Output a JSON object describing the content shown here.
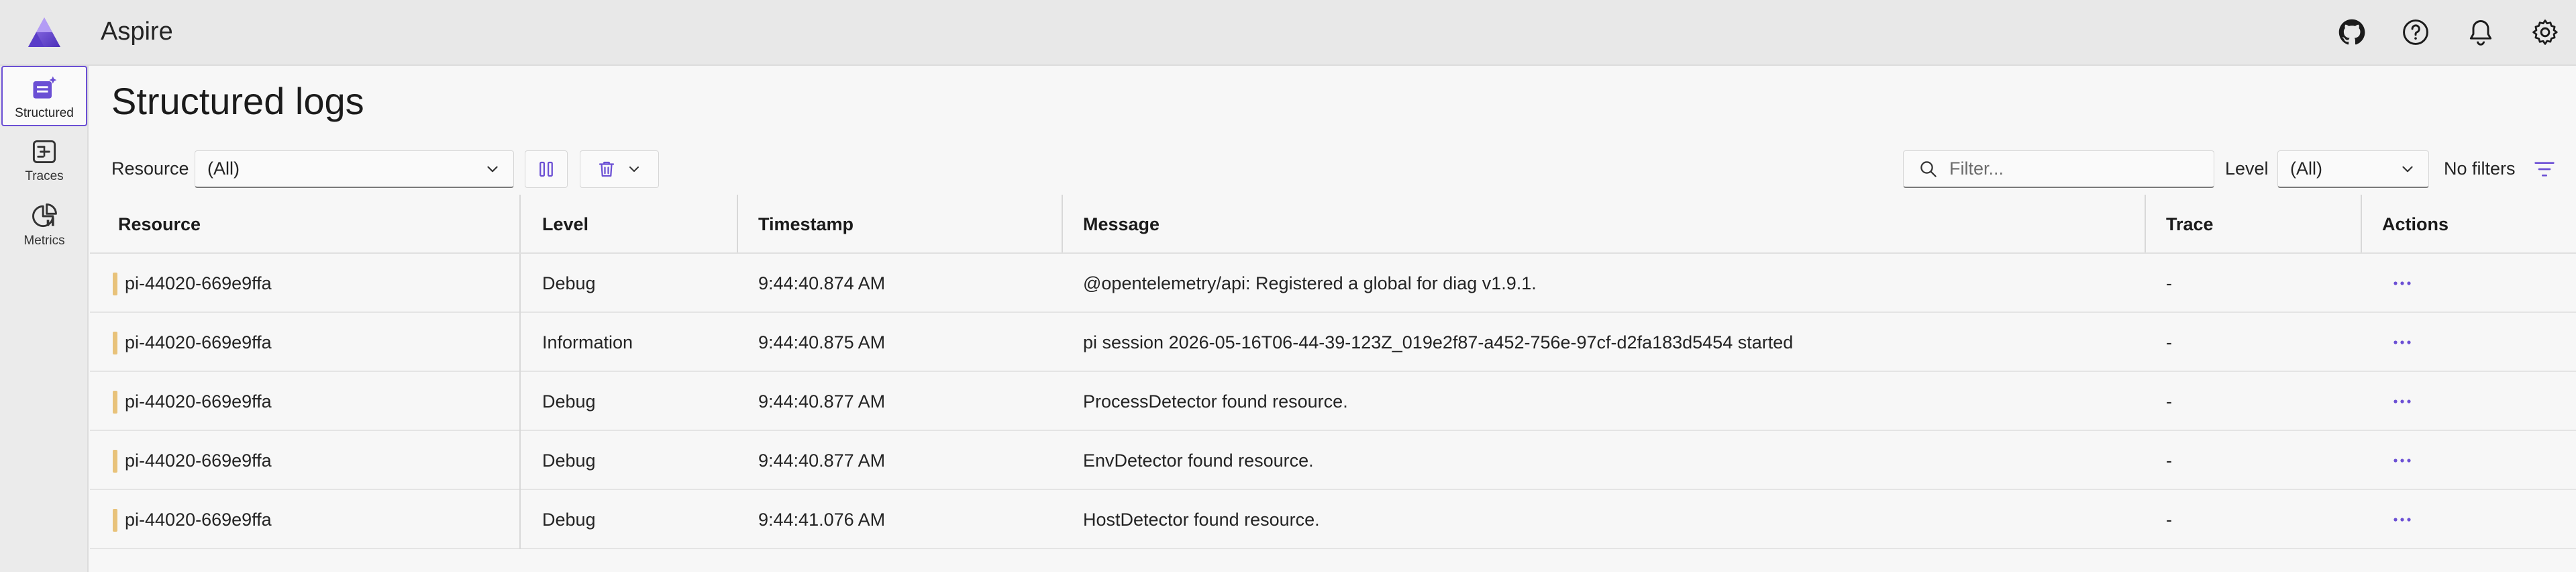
{
  "header": {
    "app_title": "Aspire",
    "icons": [
      "github-icon",
      "help-icon",
      "notifications-icon",
      "settings-icon"
    ]
  },
  "sidebar": {
    "items": [
      {
        "label": "Structured",
        "icon": "structured-logs-icon",
        "active": true
      },
      {
        "label": "Traces",
        "icon": "traces-icon",
        "active": false
      },
      {
        "label": "Metrics",
        "icon": "metrics-icon",
        "active": false
      }
    ]
  },
  "page": {
    "title": "Structured logs"
  },
  "toolbar": {
    "resource_label": "Resource",
    "resource_value": "(All)",
    "search_placeholder": "Filter...",
    "level_label": "Level",
    "level_value": "(All)",
    "filters_text": "No filters"
  },
  "table": {
    "columns": [
      "Resource",
      "Level",
      "Timestamp",
      "Message",
      "Trace",
      "Actions"
    ],
    "rows": [
      {
        "resource": "pi-44020-669e9ffa",
        "level": "Debug",
        "timestamp": "9:44:40.874 AM",
        "message": "@opentelemetry/api: Registered a global for diag v1.9.1.",
        "trace": "-"
      },
      {
        "resource": "pi-44020-669e9ffa",
        "level": "Information",
        "timestamp": "9:44:40.875 AM",
        "message": "pi session 2026-05-16T06-44-39-123Z_019e2f87-a452-756e-97cf-d2fa183d5454 started",
        "trace": "-"
      },
      {
        "resource": "pi-44020-669e9ffa",
        "level": "Debug",
        "timestamp": "9:44:40.877 AM",
        "message": "ProcessDetector found resource.",
        "trace": "-"
      },
      {
        "resource": "pi-44020-669e9ffa",
        "level": "Debug",
        "timestamp": "9:44:40.877 AM",
        "message": "EnvDetector found resource.",
        "trace": "-"
      },
      {
        "resource": "pi-44020-669e9ffa",
        "level": "Debug",
        "timestamp": "9:44:41.076 AM",
        "message": "HostDetector found resource.",
        "trace": "-"
      }
    ]
  },
  "colors": {
    "accent": "#6b4fd4",
    "resource_marker": "#e8c27a"
  }
}
